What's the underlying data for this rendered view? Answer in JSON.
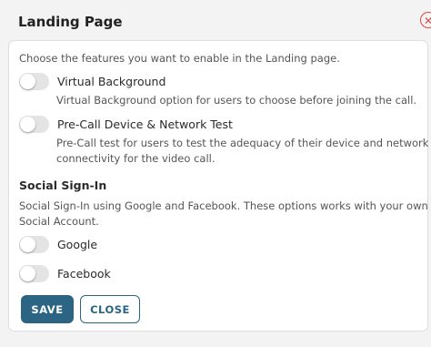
{
  "dialog": {
    "title": "Landing Page",
    "close_icon_glyph": "✕"
  },
  "panel": {
    "intro": "Choose the features you want to enable in the Landing page.",
    "options": [
      {
        "label": "Virtual Background",
        "enabled": false,
        "description": [
          "Virtual Background option for users to choose before joining the call."
        ]
      },
      {
        "label": "Pre-Call Device & Network Test",
        "enabled": false,
        "description": [
          "Pre-Call test for users to test the adequacy of their device and network",
          "connectivity for the video call."
        ]
      }
    ],
    "social": {
      "title": "Social Sign-In",
      "description": [
        "Social Sign-In using Google and Facebook. These options works with your own",
        "Social Account."
      ],
      "options": [
        {
          "label": "Google",
          "enabled": false
        },
        {
          "label": "Facebook",
          "enabled": false
        }
      ]
    }
  },
  "buttons": {
    "save": "SAVE",
    "close": "CLOSE"
  },
  "colors": {
    "accent": "#2b6583",
    "close_icon": "#e04848",
    "toggle_off": "#e4e4e4"
  }
}
